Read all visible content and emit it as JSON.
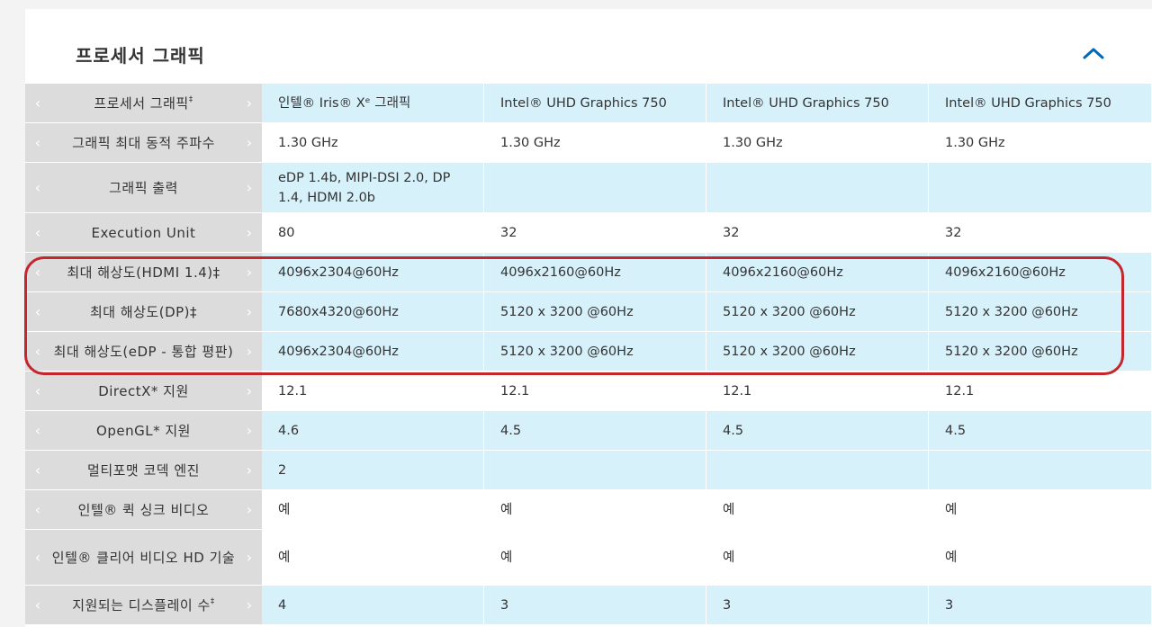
{
  "section": {
    "title": "프로세서 그래픽"
  },
  "nav": {
    "prev_glyph": "‹",
    "next_glyph": "›"
  },
  "rows": [
    {
      "label": "프로세서 그래픽",
      "sup": "‡",
      "values": [
        "인텔® Iris® Xᵉ 그래픽",
        "Intel® UHD Graphics 750",
        "Intel® UHD Graphics 750",
        "Intel® UHD Graphics 750"
      ]
    },
    {
      "label": "그래픽 최대 동적 주파수",
      "sup": "",
      "values": [
        "1.30 GHz",
        "1.30 GHz",
        "1.30 GHz",
        "1.30 GHz"
      ]
    },
    {
      "label": "그래픽 출력",
      "sup": "",
      "values": [
        "eDP 1.4b, MIPI-DSI 2.0, DP 1.4, HDMI 2.0b",
        "",
        "",
        ""
      ]
    },
    {
      "label": "Execution Unit",
      "sup": "",
      "values": [
        "80",
        "32",
        "32",
        "32"
      ]
    },
    {
      "label": "최대 해상도(HDMI 1.4)‡",
      "sup": "",
      "values": [
        "4096x2304@60Hz",
        "4096x2160@60Hz",
        "4096x2160@60Hz",
        "4096x2160@60Hz"
      ]
    },
    {
      "label": "최대 해상도(DP)‡",
      "sup": "",
      "values": [
        "7680x4320@60Hz",
        "5120 x 3200 @60Hz",
        "5120 x 3200 @60Hz",
        "5120 x 3200 @60Hz"
      ]
    },
    {
      "label": "최대 해상도(eDP - 통합 평판)",
      "sup": "",
      "values": [
        "4096x2304@60Hz",
        "5120 x 3200 @60Hz",
        "5120 x 3200 @60Hz",
        "5120 x 3200 @60Hz"
      ]
    },
    {
      "label": "DirectX* 지원",
      "sup": "",
      "values": [
        "12.1",
        "12.1",
        "12.1",
        "12.1"
      ]
    },
    {
      "label": "OpenGL* 지원",
      "sup": "",
      "values": [
        "4.6",
        "4.5",
        "4.5",
        "4.5"
      ]
    },
    {
      "label": "멀티포맷 코덱 엔진",
      "sup": "",
      "values": [
        "2",
        "",
        "",
        ""
      ]
    },
    {
      "label": "인텔® 퀵 싱크 비디오",
      "sup": "",
      "values": [
        "예",
        "예",
        "예",
        "예"
      ]
    },
    {
      "label": "인텔® 클리어 비디오 HD 기술",
      "sup": "",
      "values": [
        "예",
        "예",
        "예",
        "예"
      ]
    },
    {
      "label": "지원되는 디스플레이 수",
      "sup": "‡",
      "values": [
        "4",
        "3",
        "3",
        "3"
      ]
    }
  ],
  "colors": {
    "accent": "#0068b5",
    "highlight_border": "#c4262e",
    "row_tint": "#d7f1fb",
    "label_bg": "#dcdcdc"
  }
}
